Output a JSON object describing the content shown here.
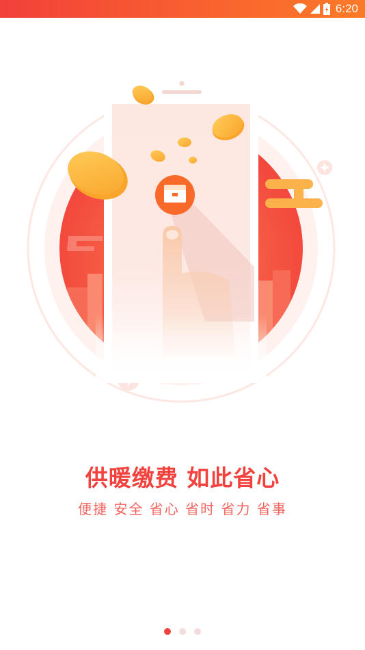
{
  "status_bar": {
    "time": "6:20"
  },
  "headline": "供暖缴费 如此省心",
  "subline": "便捷 安全 省心 省时 省力 省事",
  "pager": {
    "count": 3,
    "active_index": 0
  },
  "colors": {
    "accent": "#f1423d",
    "status_bar": "#f55a32",
    "coin": "#fbb43b"
  }
}
